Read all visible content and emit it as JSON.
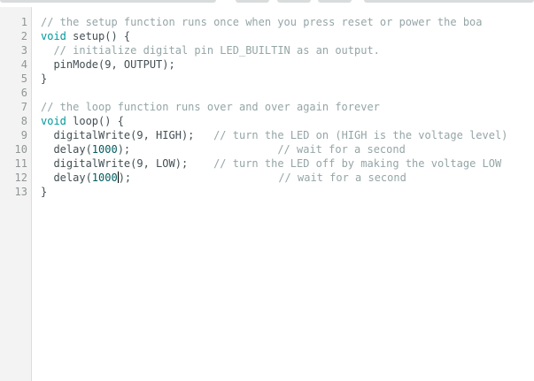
{
  "editor": {
    "line_numbers": [
      "1",
      "2",
      "3",
      "4",
      "5",
      "6",
      "7",
      "8",
      "9",
      "10",
      "11",
      "12",
      "13"
    ],
    "lines": [
      [
        {
          "t": "cm",
          "v": "// the setup function runs once when you press reset or power the boa"
        }
      ],
      [
        {
          "t": "kw",
          "v": "void"
        },
        {
          "t": "tx",
          "v": " setup() {"
        }
      ],
      [
        {
          "t": "tx",
          "v": "  "
        },
        {
          "t": "cm",
          "v": "// initialize digital pin LED_BUILTIN as an output."
        }
      ],
      [
        {
          "t": "tx",
          "v": "  pinMode(9, OUTPUT);"
        }
      ],
      [
        {
          "t": "tx",
          "v": "}"
        }
      ],
      [],
      [
        {
          "t": "cm",
          "v": "// the loop function runs over and over again forever"
        }
      ],
      [
        {
          "t": "kw",
          "v": "void"
        },
        {
          "t": "tx",
          "v": " loop() {"
        }
      ],
      [
        {
          "t": "tx",
          "v": "  digitalWrite(9, HIGH);   "
        },
        {
          "t": "cm",
          "v": "// turn the LED on (HIGH is the voltage level)"
        }
      ],
      [
        {
          "t": "tx",
          "v": "  delay("
        },
        {
          "t": "num",
          "v": "1000"
        },
        {
          "t": "tx",
          "v": ");                       "
        },
        {
          "t": "cm",
          "v": "// wait for a second"
        }
      ],
      [
        {
          "t": "tx",
          "v": "  digitalWrite(9, LOW);    "
        },
        {
          "t": "cm",
          "v": "// turn the LED off by making the voltage LOW"
        }
      ],
      [
        {
          "t": "tx",
          "v": "  delay("
        },
        {
          "t": "num",
          "v": "1000"
        },
        {
          "t": "cursor"
        },
        {
          "t": "tx",
          "v": ");                       "
        },
        {
          "t": "cm",
          "v": "// wait for a second"
        }
      ],
      [
        {
          "t": "tx",
          "v": "}"
        }
      ]
    ]
  },
  "colors": {
    "keyword": "#00979c",
    "comment": "#95a5a6",
    "number": "#005c5f",
    "text": "#434f54",
    "gutter_bg": "#f3f3f3",
    "line_number": "#8f9595"
  }
}
